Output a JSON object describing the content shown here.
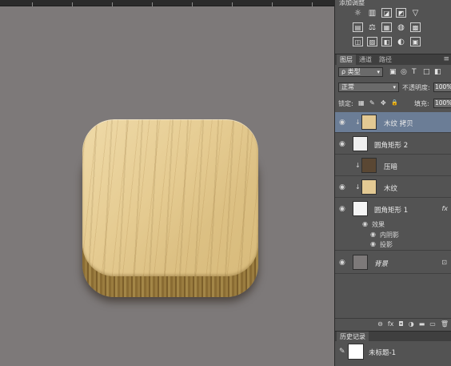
{
  "adjustments": {
    "header": "添加调整",
    "row1": [
      "sun-icon",
      "levels-icon",
      "curves-icon",
      "exposure-icon",
      "triangle-icon"
    ],
    "row2": [
      "vibrance-icon",
      "balance-icon",
      "colorbalance-icon",
      "photo-filter-icon",
      "channel-mixer-icon"
    ],
    "row3": [
      "invert-icon",
      "posterize-icon",
      "threshold-icon",
      "selective-color-icon",
      "gradient-map-icon"
    ],
    "glyphs1": [
      "☼",
      "▥",
      "◪",
      "◩",
      "▽"
    ],
    "glyphs2": [
      "▤",
      "⚖",
      "▦",
      "◍",
      "▩"
    ],
    "glyphs3": [
      "◫",
      "▨",
      "◧",
      "◐",
      "▣"
    ]
  },
  "layers_panel": {
    "tabs": [
      "图层",
      "通道",
      "路径"
    ],
    "filter_label": "ρ 类型",
    "filter_icons": [
      "▣",
      "◎",
      "T",
      "□",
      "◧"
    ],
    "blend_mode": "正常",
    "opacity_label": "不透明度:",
    "opacity_value": "100%",
    "lock_label": "锁定:",
    "lock_icons": [
      "▦",
      "✎",
      "✥",
      "🔒"
    ],
    "fill_label": "填充:",
    "fill_value": "100%",
    "layers": [
      {
        "name": "木纹 拷贝",
        "selected": true
      },
      {
        "name": "圆角矩形 2",
        "selected": false
      },
      {
        "name": "压暗",
        "selected": false
      },
      {
        "name": "木纹",
        "selected": false
      },
      {
        "name": "圆角矩形 1",
        "selected": false
      },
      {
        "name": "背景",
        "selected": false
      }
    ],
    "effects_header": "效果",
    "effects": [
      "内阴影",
      "投影"
    ],
    "fx_label": "fx",
    "footer_icons": [
      "⊖",
      "fx",
      "◘",
      "◑",
      "▬",
      "▭",
      "🗑"
    ]
  },
  "history": {
    "tab_label": "历史记录",
    "item": "未标题-1"
  }
}
